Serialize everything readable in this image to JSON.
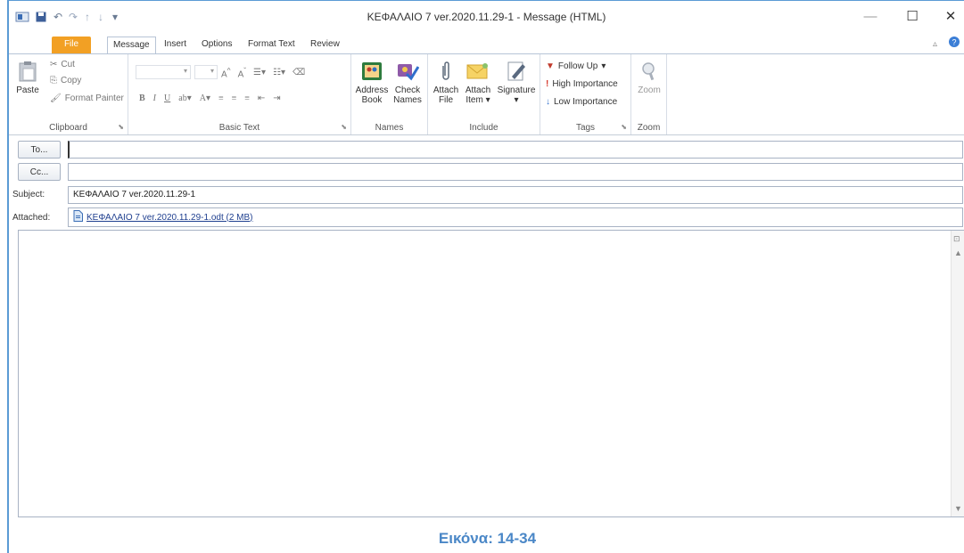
{
  "window": {
    "title": "ΚΕΦΑΛΑΙΟ 7 ver.2020.11.29-1  -  Message (HTML)",
    "minimize": "—",
    "maximize": "☐",
    "close": "✕"
  },
  "tabs": [
    "File",
    "Message",
    "Insert",
    "Options",
    "Format Text",
    "Review"
  ],
  "ribbon": {
    "clipboard": {
      "paste": "Paste",
      "cut": "Cut",
      "copy": "Copy",
      "format_painter": "Format Painter",
      "label": "Clipboard"
    },
    "basic_text": {
      "label": "Basic Text"
    },
    "names": {
      "address_book_1": "Address",
      "address_book_2": "Book",
      "check_names_1": "Check",
      "check_names_2": "Names",
      "label": "Names"
    },
    "include": {
      "attach_file_1": "Attach",
      "attach_file_2": "File",
      "attach_item_1": "Attach",
      "attach_item_2": "Item",
      "signature": "Signature",
      "label": "Include"
    },
    "tags": {
      "follow_up": "Follow Up",
      "high_importance": "High Importance",
      "low_importance": "Low Importance",
      "label": "Tags"
    },
    "zoom": {
      "zoom": "Zoom",
      "label": "Zoom"
    }
  },
  "fields": {
    "to_button": "To...",
    "cc_button": "Cc...",
    "to_value": "",
    "cc_value": "",
    "subject_label": "Subject:",
    "subject_value": "ΚΕΦΑΛΑΙΟ 7 ver.2020.11.29-1",
    "attached_label": "Attached:",
    "attached_value": "ΚΕΦΑΛΑΙΟ 7 ver.2020.11.29-1.odt (2 MB)"
  },
  "caption": "Εικόνα: 14-34",
  "colors": {
    "accent": "#5b9bd5",
    "file_tab": "#f2a024",
    "caption": "#4a87c7"
  }
}
